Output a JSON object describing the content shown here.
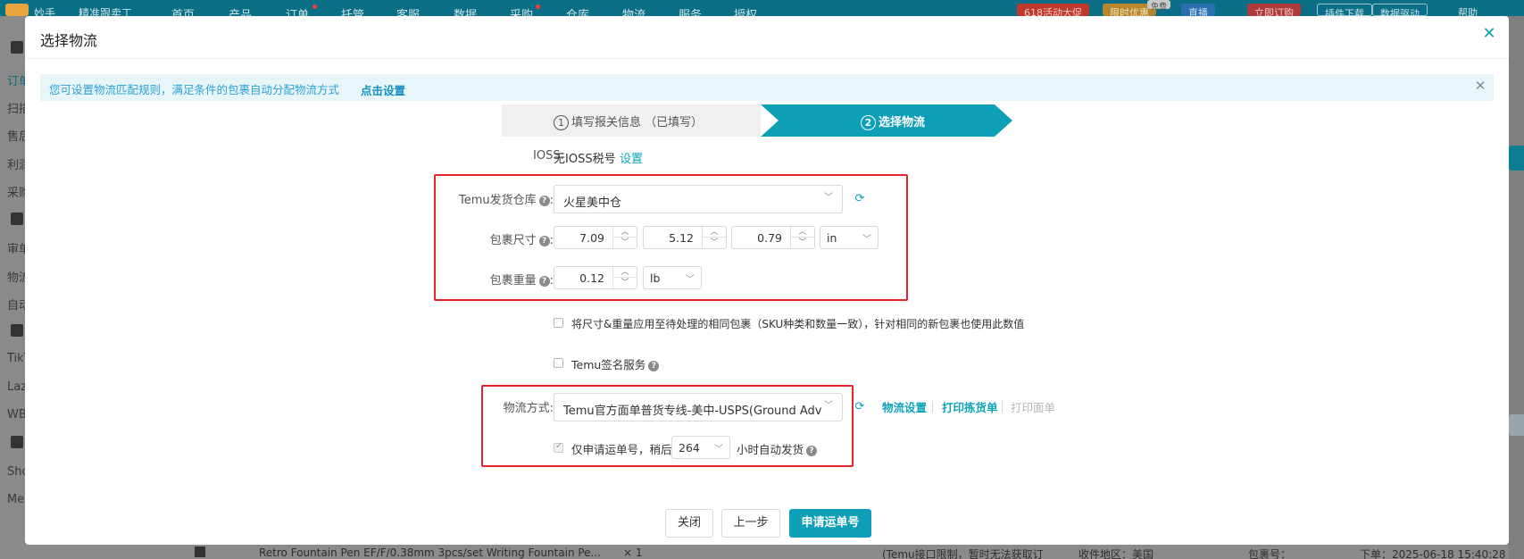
{
  "background": {
    "nav": [
      "妙手",
      "精准跟卖工",
      "首页",
      "产品",
      "订单",
      "托管",
      "客服",
      "数据",
      "采购",
      "仓库",
      "物流",
      "服务",
      "授权"
    ],
    "top_pills": [
      "618活动大促",
      "限时优惠",
      "免费",
      "直播",
      "立即订购",
      "插件下载",
      "数据驱动",
      "帮助"
    ],
    "sidebar": [
      "订单",
      "扫描",
      "售后",
      "利润",
      "采购",
      "审单",
      "物流",
      "自动",
      "TikT",
      "Laz",
      "WB",
      "Sho",
      "Me"
    ],
    "bottom_row": {
      "product": "Retro Fountain Pen EF/F/0.38mm 3pcs/set Writing Fountain Pe...",
      "qty": "× 1",
      "note": "(Temu接口限制，暂时无法获取订",
      "receiver_region": "收件地区：美国",
      "package_no": "包裹号：",
      "order_time": "下单：2025-06-18 15:40:28"
    }
  },
  "modal": {
    "title": "选择物流",
    "close_icon": "close-icon",
    "notice": {
      "text": "您可设置物流匹配规则，满足条件的包裹自动分配物流方式",
      "link": "点击设置"
    },
    "steps": [
      {
        "num": "1",
        "label": "填写报关信息 （已填写）"
      },
      {
        "num": "2",
        "label": "选择物流"
      }
    ],
    "ioss": {
      "label": "IOSS:",
      "value": "无IOSS税号",
      "link": "设置"
    },
    "warehouse": {
      "label": "Temu发货仓库",
      "value": "火星美中仓"
    },
    "size": {
      "label": "包裹尺寸",
      "length": "7.09",
      "width": "5.12",
      "height": "0.79",
      "unit": "in"
    },
    "weight": {
      "label": "包裹重量",
      "value": "0.12",
      "unit": "lb"
    },
    "apply_same": {
      "label": "将尺寸&重量应用至待处理的相同包裹（SKU种类和数量一致），针对相同的新包裹也使用此数值",
      "checked": false
    },
    "signature": {
      "label": "Temu签名服务",
      "checked": false
    },
    "method": {
      "label": "物流方式:",
      "value": "Temu官方面单普货专线-美中-USPS(Ground Advan",
      "links": {
        "settings": "物流设置",
        "print_pick": "打印拣货单",
        "print_label": "打印面单"
      }
    },
    "auto_ship": {
      "prefix": "仅申请运单号，稍后",
      "hours": "264",
      "suffix": "小时自动发货",
      "checked": true
    },
    "buttons": {
      "close": "关闭",
      "prev": "上一步",
      "submit": "申请运单号"
    }
  },
  "colors": {
    "accent": "#0d9fb5",
    "highlight_box": "#e7242b",
    "notice_bg": "#e8f6fa"
  }
}
